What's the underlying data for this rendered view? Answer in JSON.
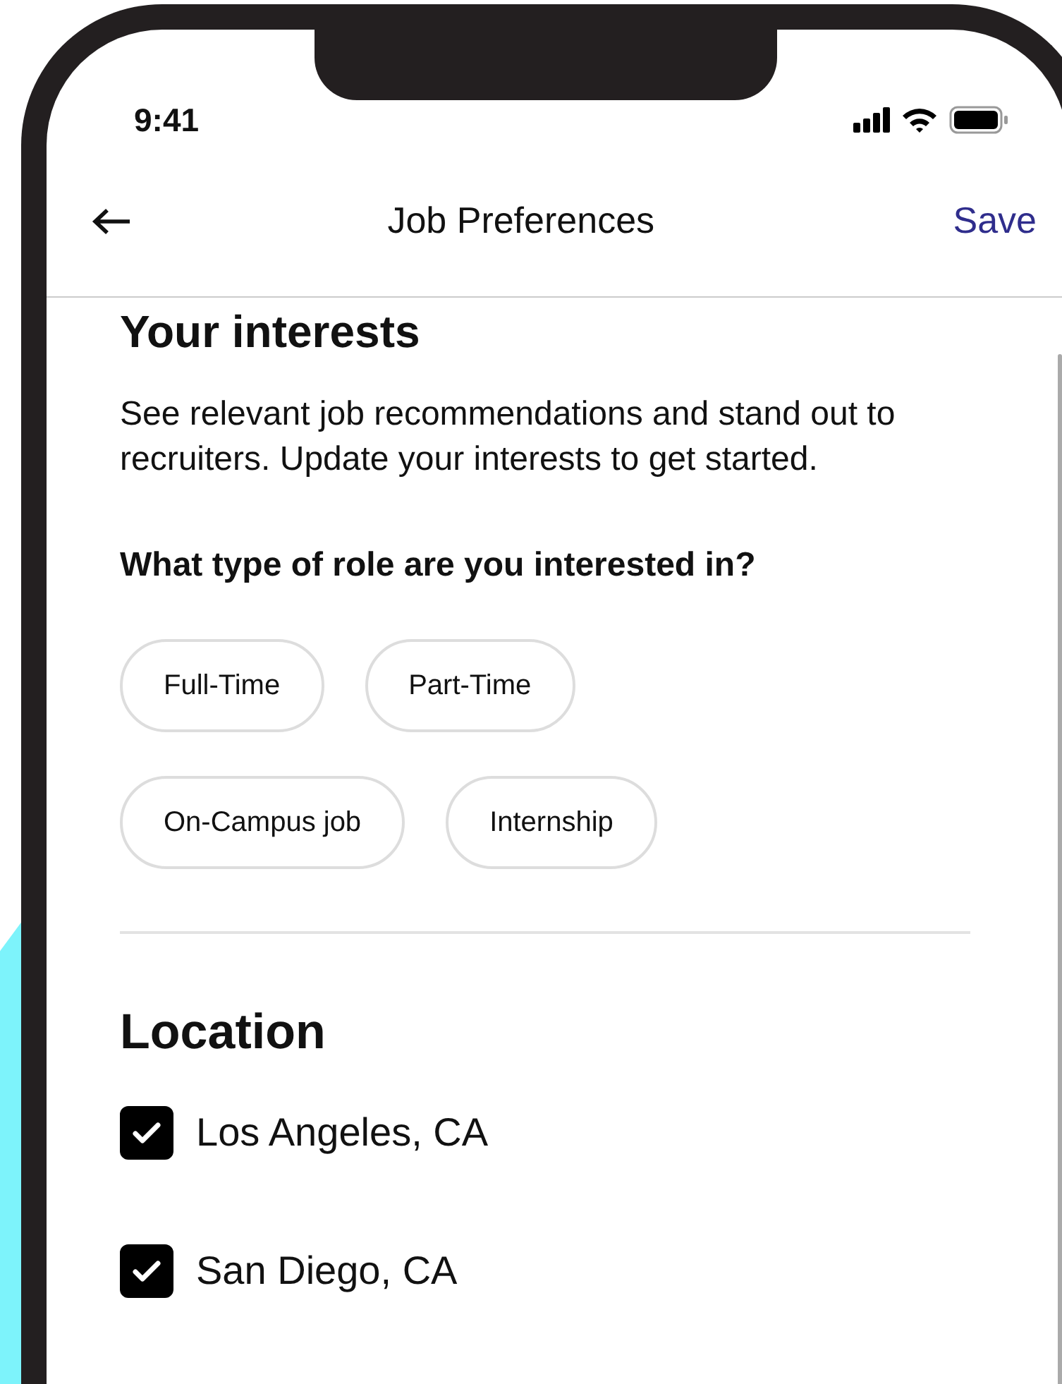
{
  "status_bar": {
    "time": "9:41"
  },
  "nav": {
    "title": "Job Preferences",
    "action": "Save"
  },
  "interests": {
    "title": "Your interests",
    "description": "See relevant job recommendations and stand out to recruiters. Update your interests to get started.",
    "question": "What type of role are you interested in?",
    "role_options": [
      {
        "label": "Full-Time",
        "selected": false
      },
      {
        "label": "Part-Time",
        "selected": false
      },
      {
        "label": "On-Campus job",
        "selected": false
      },
      {
        "label": "Internship",
        "selected": false
      }
    ]
  },
  "location": {
    "title": "Location",
    "options": [
      {
        "label": "Los Angeles, CA",
        "checked": true
      },
      {
        "label": "San Diego, CA",
        "checked": true
      }
    ]
  }
}
